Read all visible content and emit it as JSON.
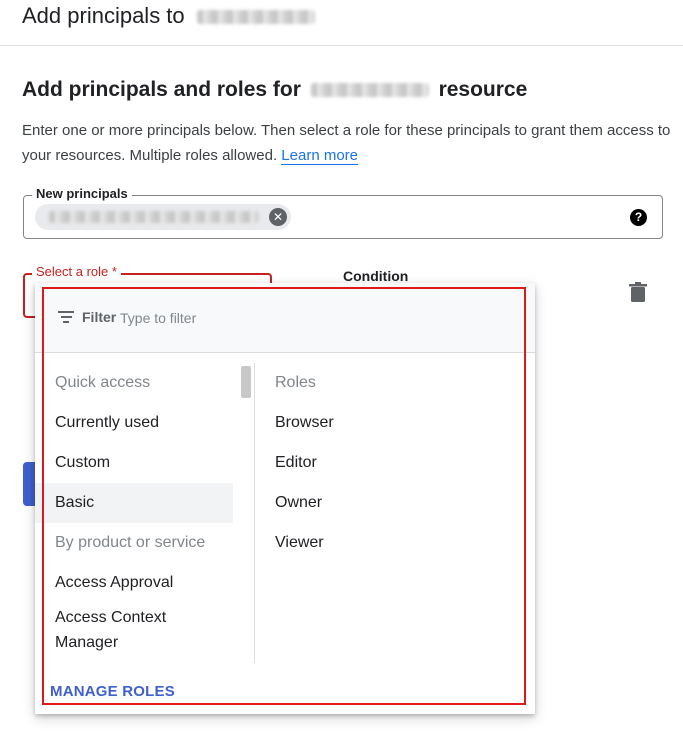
{
  "header": {
    "title": "Add principals to"
  },
  "section": {
    "title_prefix": "Add principals and roles for",
    "title_suffix": "resource"
  },
  "description": {
    "text": "Enter one or more principals below. Then select a role for these principals to grant them access to your resources. Multiple roles allowed.",
    "link": "Learn more"
  },
  "principals": {
    "label": "New principals",
    "chip_close": "✕",
    "help_icon": "?"
  },
  "role_field": {
    "label": "Select a role *"
  },
  "condition": {
    "label": "Condition"
  },
  "dropdown": {
    "filter_label": "Filter",
    "filter_placeholder": "Type to filter",
    "left_items": [
      {
        "label": "Quick access",
        "kind": "category"
      },
      {
        "label": "Currently used",
        "kind": "option"
      },
      {
        "label": "Custom",
        "kind": "option"
      },
      {
        "label": "Basic",
        "kind": "option-selected"
      },
      {
        "label": "By product or service",
        "kind": "category"
      },
      {
        "label": "Access Approval",
        "kind": "option"
      },
      {
        "label": "Access Context Manager",
        "kind": "option"
      }
    ],
    "right_items": [
      {
        "label": "Roles",
        "kind": "category"
      },
      {
        "label": "Browser",
        "kind": "option"
      },
      {
        "label": "Editor",
        "kind": "option"
      },
      {
        "label": "Owner",
        "kind": "option"
      },
      {
        "label": "Viewer",
        "kind": "option"
      }
    ],
    "manage_roles": "MANAGE ROLES"
  },
  "colors": {
    "accent": "#1a73e8",
    "error": "#c5221f",
    "highlight": "#e0181b",
    "manage": "#3f5fcf"
  }
}
